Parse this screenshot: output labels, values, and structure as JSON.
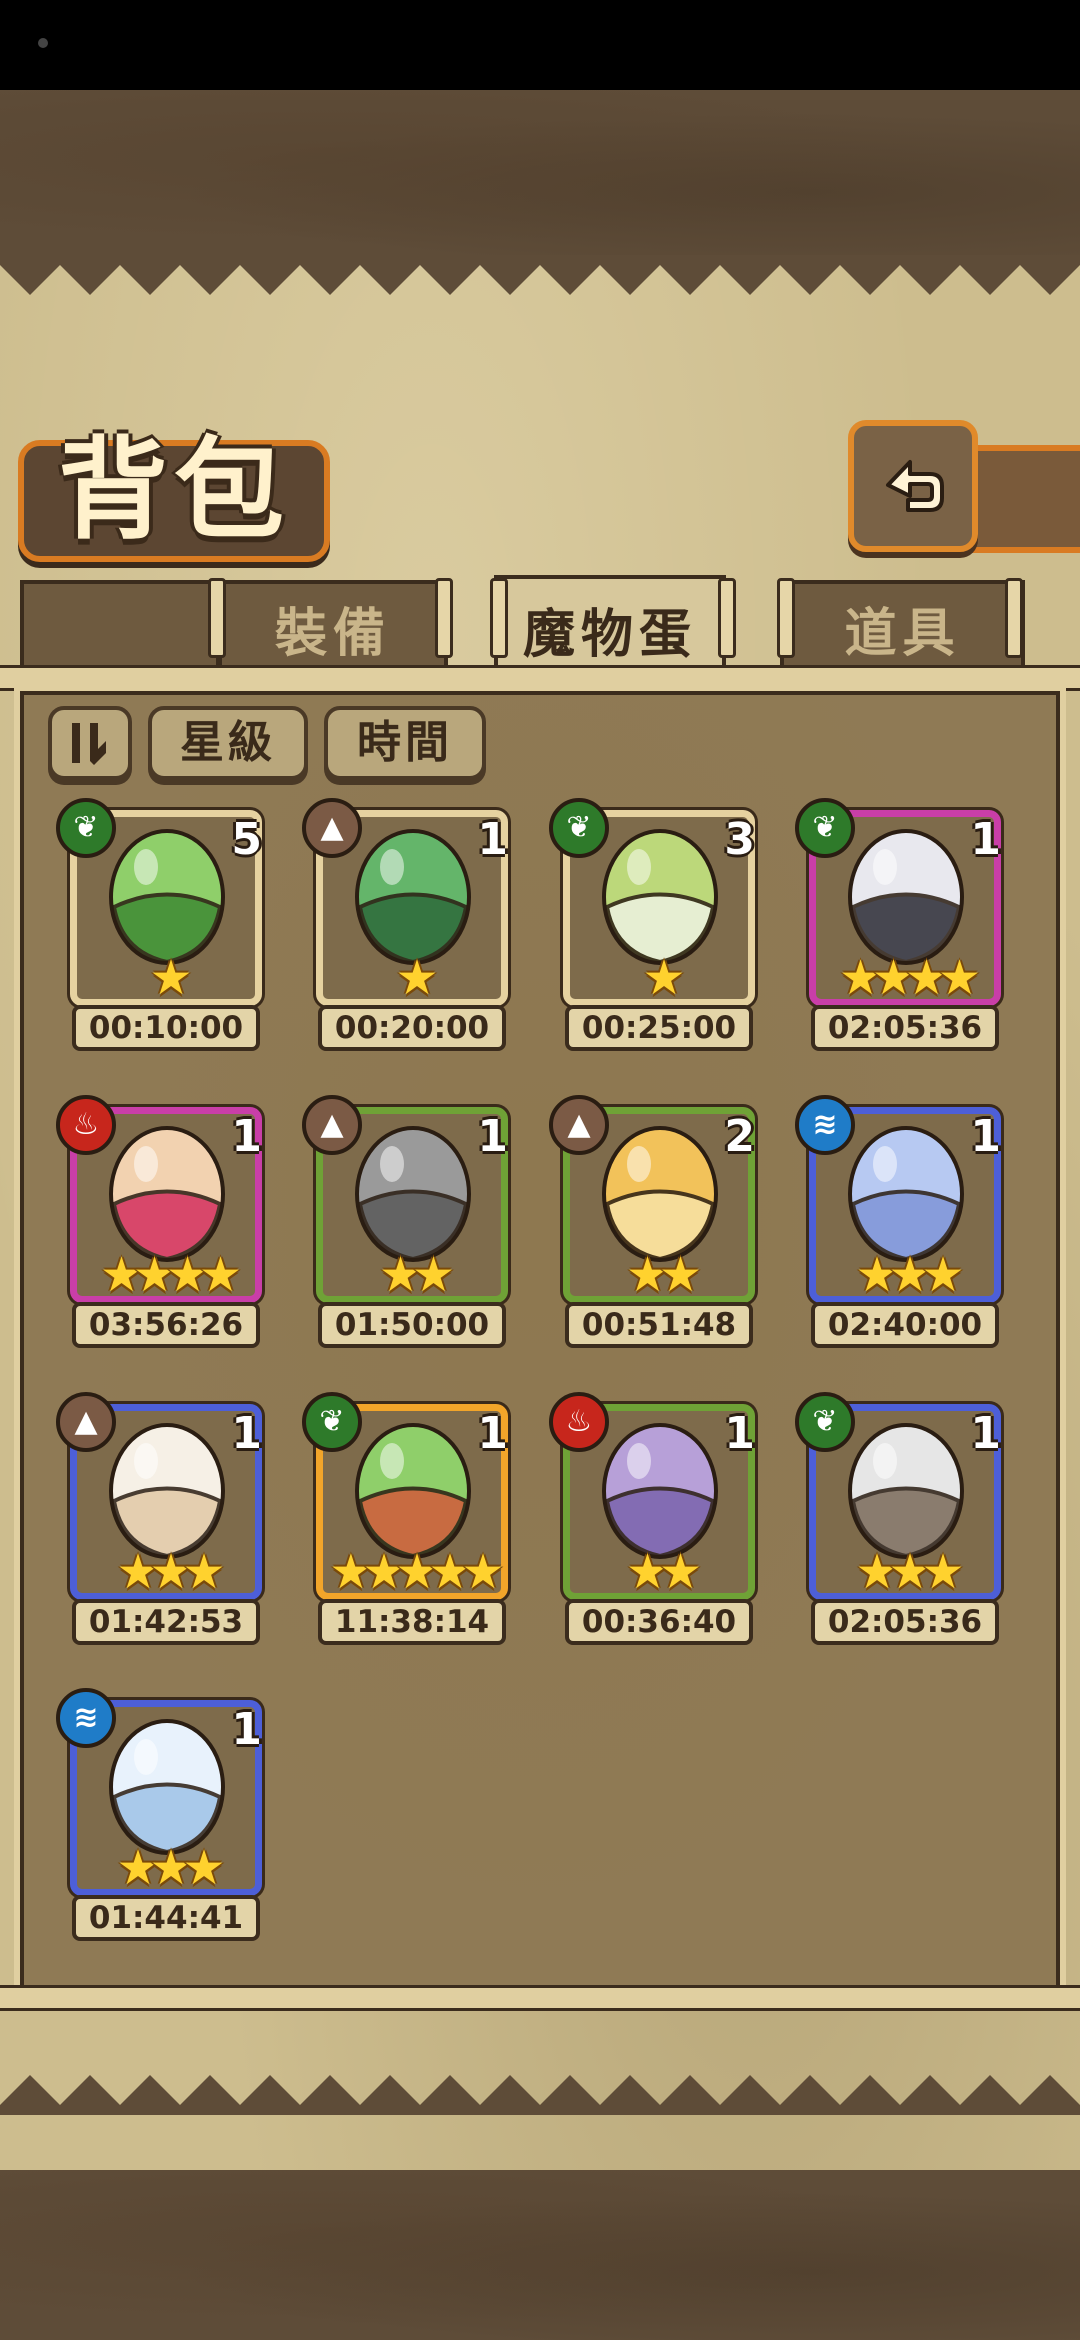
{
  "header": {
    "title": "背包",
    "back_icon": "return-arrow-icon"
  },
  "tabs": [
    {
      "label": "裝備",
      "active": false
    },
    {
      "label": "魔物蛋",
      "active": true
    },
    {
      "label": "道具",
      "active": false
    }
  ],
  "sort": {
    "toggle_icon": "sort-order-icon",
    "star_label": "星級",
    "time_label": "時間"
  },
  "colors": {
    "grass": "#2e7a2a",
    "earth": "#7b5a45",
    "fire": "#c7261c",
    "water": "#1f7cc8",
    "star": "#ffd22e"
  },
  "eggs": [
    {
      "element": "grass-icon",
      "count": "5",
      "stars": 1,
      "timer": "00:10:00",
      "frame": "tan"
    },
    {
      "element": "earth-icon",
      "count": "1",
      "stars": 1,
      "timer": "00:20:00",
      "frame": "tan"
    },
    {
      "element": "grass-icon",
      "count": "3",
      "stars": 1,
      "timer": "00:25:00",
      "frame": "tan"
    },
    {
      "element": "grass-icon",
      "count": "1",
      "stars": 4,
      "timer": "02:05:36",
      "frame": "pink"
    },
    {
      "element": "fire-icon",
      "count": "1",
      "stars": 4,
      "timer": "03:56:26",
      "frame": "pink"
    },
    {
      "element": "earth-icon",
      "count": "1",
      "stars": 2,
      "timer": "01:50:00",
      "frame": "green"
    },
    {
      "element": "earth-icon",
      "count": "2",
      "stars": 2,
      "timer": "00:51:48",
      "frame": "green"
    },
    {
      "element": "water-icon",
      "count": "1",
      "stars": 3,
      "timer": "02:40:00",
      "frame": "blue"
    },
    {
      "element": "earth-icon",
      "count": "1",
      "stars": 3,
      "timer": "01:42:53",
      "frame": "blue"
    },
    {
      "element": "grass-icon",
      "count": "1",
      "stars": 5,
      "timer": "11:38:14",
      "frame": "gold"
    },
    {
      "element": "fire-icon",
      "count": "1",
      "stars": 2,
      "timer": "00:36:40",
      "frame": "green"
    },
    {
      "element": "grass-icon",
      "count": "1",
      "stars": 3,
      "timer": "02:05:36",
      "frame": "blue"
    },
    {
      "element": "water-icon",
      "count": "1",
      "stars": 3,
      "timer": "01:44:41",
      "frame": "blue"
    }
  ]
}
